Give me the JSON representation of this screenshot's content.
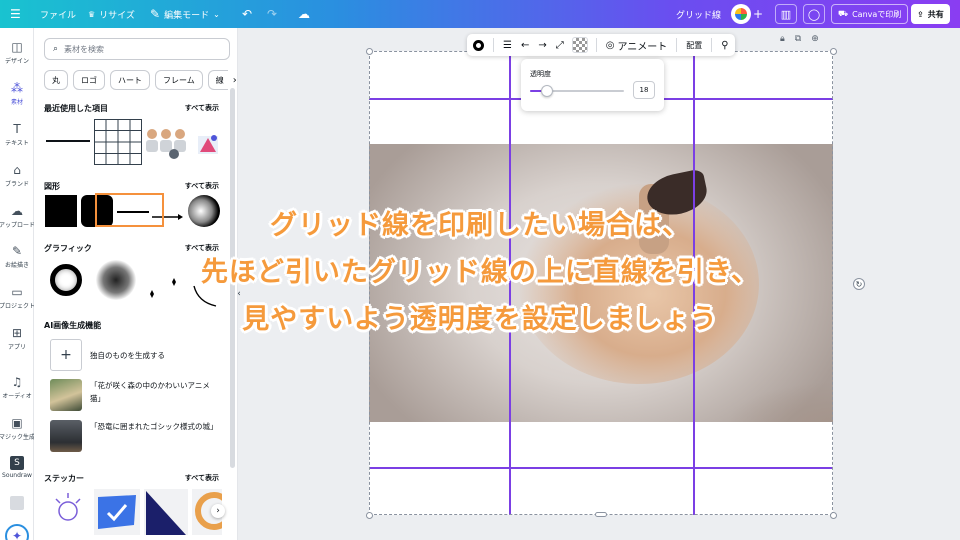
{
  "topbar": {
    "menu_icon": "hamburger-icon",
    "file": "ファイル",
    "resize": "リサイズ",
    "edit_mode": "編集モード",
    "doc_title": "グリッド線",
    "canva_button": "Canvaで印刷",
    "share": "共有"
  },
  "rail": {
    "items": [
      {
        "label": "デザイン",
        "icon": "layout-icon"
      },
      {
        "label": "素材",
        "icon": "elements-icon"
      },
      {
        "label": "テキスト",
        "icon": "text-icon"
      },
      {
        "label": "ブランド",
        "icon": "brand-icon"
      },
      {
        "label": "アップロード",
        "icon": "upload-icon"
      },
      {
        "label": "お絵描き",
        "icon": "draw-icon"
      },
      {
        "label": "プロジェクト",
        "icon": "folder-icon"
      },
      {
        "label": "アプリ",
        "icon": "apps-icon"
      },
      {
        "label": "オーディオ",
        "icon": "audio-icon"
      },
      {
        "label": "マジック生成",
        "icon": "magic-icon"
      },
      {
        "label": "Soundraw",
        "icon": "soundraw-icon"
      }
    ]
  },
  "panel": {
    "search_placeholder": "素材を検索",
    "chips": [
      "丸",
      "ロゴ",
      "ハート",
      "フレーム",
      "線"
    ],
    "recent_title": "最近使用した項目",
    "shapes_title": "図形",
    "graphics_title": "グラフィック",
    "ai_title": "AI画像生成機能",
    "stickers_title": "ステッカー",
    "see_all": "すべて表示",
    "ai_items": [
      "独自のものを生成する",
      "「花が咲く森の中のかわいいアニメ猫」",
      "「恐竜に囲まれたゴシック様式の城」"
    ]
  },
  "toolbar": {
    "animate": "アニメート",
    "position": "配置"
  },
  "transparency": {
    "label": "透明度",
    "value": "18",
    "level": 0.18
  },
  "caption": {
    "line1": "グリッド線を印刷したい場合は、",
    "line2": "先ほど引いたグリッド線の上に直線を引き、",
    "line3": "見やすいよう透明度を設定しましょう"
  },
  "colors": {
    "accent": "#7b3fe4",
    "caption": "#f59a3c",
    "highlight_box": "#f5913c"
  }
}
